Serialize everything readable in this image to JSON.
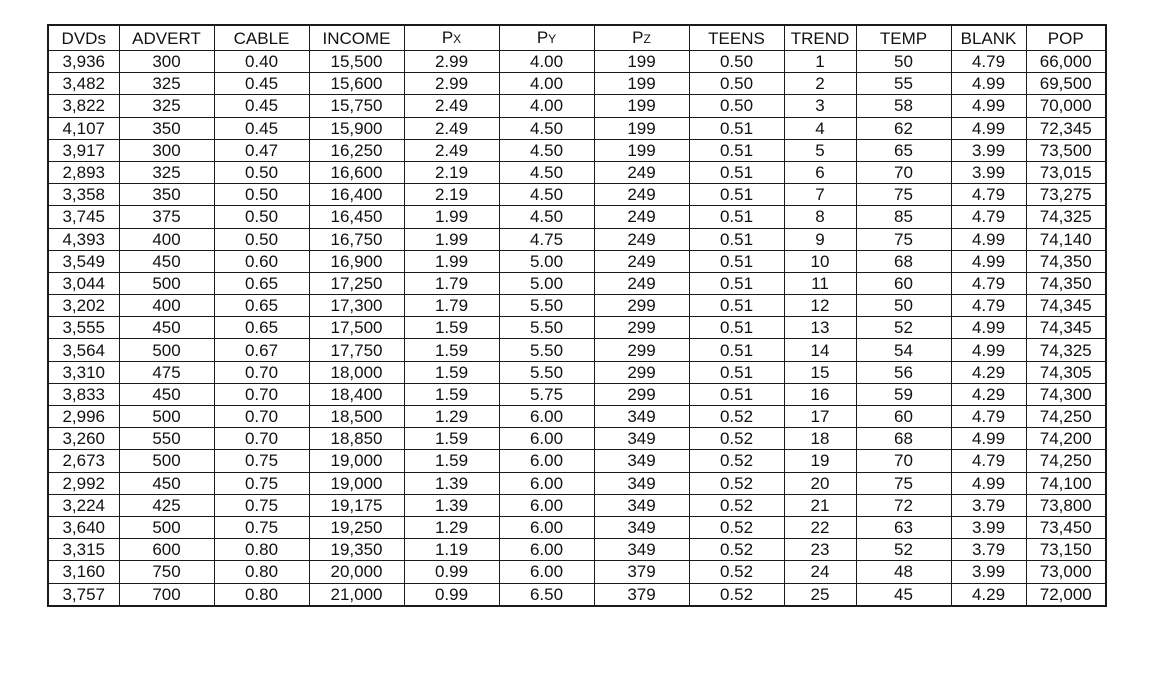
{
  "table": {
    "headers": [
      {
        "main": "DVDs",
        "sub": ""
      },
      {
        "main": "ADVERT",
        "sub": ""
      },
      {
        "main": "CABLE",
        "sub": ""
      },
      {
        "main": "INCOME",
        "sub": ""
      },
      {
        "main": "P",
        "sub": "X"
      },
      {
        "main": "P",
        "sub": "Y"
      },
      {
        "main": "P",
        "sub": "Z"
      },
      {
        "main": "TEENS",
        "sub": ""
      },
      {
        "main": "TREND",
        "sub": ""
      },
      {
        "main": "TEMP",
        "sub": ""
      },
      {
        "main": "BLANK",
        "sub": ""
      },
      {
        "main": "POP",
        "sub": ""
      }
    ],
    "rows": [
      [
        "3,936",
        "300",
        "0.40",
        "15,500",
        "2.99",
        "4.00",
        "199",
        "0.50",
        "1",
        "50",
        "4.79",
        "66,000"
      ],
      [
        "3,482",
        "325",
        "0.45",
        "15,600",
        "2.99",
        "4.00",
        "199",
        "0.50",
        "2",
        "55",
        "4.99",
        "69,500"
      ],
      [
        "3,822",
        "325",
        "0.45",
        "15,750",
        "2.49",
        "4.00",
        "199",
        "0.50",
        "3",
        "58",
        "4.99",
        "70,000"
      ],
      [
        "4,107",
        "350",
        "0.45",
        "15,900",
        "2.49",
        "4.50",
        "199",
        "0.51",
        "4",
        "62",
        "4.99",
        "72,345"
      ],
      [
        "3,917",
        "300",
        "0.47",
        "16,250",
        "2.49",
        "4.50",
        "199",
        "0.51",
        "5",
        "65",
        "3.99",
        "73,500"
      ],
      [
        "2,893",
        "325",
        "0.50",
        "16,600",
        "2.19",
        "4.50",
        "249",
        "0.51",
        "6",
        "70",
        "3.99",
        "73,015"
      ],
      [
        "3,358",
        "350",
        "0.50",
        "16,400",
        "2.19",
        "4.50",
        "249",
        "0.51",
        "7",
        "75",
        "4.79",
        "73,275"
      ],
      [
        "3,745",
        "375",
        "0.50",
        "16,450",
        "1.99",
        "4.50",
        "249",
        "0.51",
        "8",
        "85",
        "4.79",
        "74,325"
      ],
      [
        "4,393",
        "400",
        "0.50",
        "16,750",
        "1.99",
        "4.75",
        "249",
        "0.51",
        "9",
        "75",
        "4.99",
        "74,140"
      ],
      [
        "3,549",
        "450",
        "0.60",
        "16,900",
        "1.99",
        "5.00",
        "249",
        "0.51",
        "10",
        "68",
        "4.99",
        "74,350"
      ],
      [
        "3,044",
        "500",
        "0.65",
        "17,250",
        "1.79",
        "5.00",
        "249",
        "0.51",
        "11",
        "60",
        "4.79",
        "74,350"
      ],
      [
        "3,202",
        "400",
        "0.65",
        "17,300",
        "1.79",
        "5.50",
        "299",
        "0.51",
        "12",
        "50",
        "4.79",
        "74,345"
      ],
      [
        "3,555",
        "450",
        "0.65",
        "17,500",
        "1.59",
        "5.50",
        "299",
        "0.51",
        "13",
        "52",
        "4.99",
        "74,345"
      ],
      [
        "3,564",
        "500",
        "0.67",
        "17,750",
        "1.59",
        "5.50",
        "299",
        "0.51",
        "14",
        "54",
        "4.99",
        "74,325"
      ],
      [
        "3,310",
        "475",
        "0.70",
        "18,000",
        "1.59",
        "5.50",
        "299",
        "0.51",
        "15",
        "56",
        "4.29",
        "74,305"
      ],
      [
        "3,833",
        "450",
        "0.70",
        "18,400",
        "1.59",
        "5.75",
        "299",
        "0.51",
        "16",
        "59",
        "4.29",
        "74,300"
      ],
      [
        "2,996",
        "500",
        "0.70",
        "18,500",
        "1.29",
        "6.00",
        "349",
        "0.52",
        "17",
        "60",
        "4.79",
        "74,250"
      ],
      [
        "3,260",
        "550",
        "0.70",
        "18,850",
        "1.59",
        "6.00",
        "349",
        "0.52",
        "18",
        "68",
        "4.99",
        "74,200"
      ],
      [
        "2,673",
        "500",
        "0.75",
        "19,000",
        "1.59",
        "6.00",
        "349",
        "0.52",
        "19",
        "70",
        "4.79",
        "74,250"
      ],
      [
        "2,992",
        "450",
        "0.75",
        "19,000",
        "1.39",
        "6.00",
        "349",
        "0.52",
        "20",
        "75",
        "4.99",
        "74,100"
      ],
      [
        "3,224",
        "425",
        "0.75",
        "19,175",
        "1.39",
        "6.00",
        "349",
        "0.52",
        "21",
        "72",
        "3.79",
        "73,800"
      ],
      [
        "3,640",
        "500",
        "0.75",
        "19,250",
        "1.29",
        "6.00",
        "349",
        "0.52",
        "22",
        "63",
        "3.99",
        "73,450"
      ],
      [
        "3,315",
        "600",
        "0.80",
        "19,350",
        "1.19",
        "6.00",
        "349",
        "0.52",
        "23",
        "52",
        "3.79",
        "73,150"
      ],
      [
        "3,160",
        "750",
        "0.80",
        "20,000",
        "0.99",
        "6.00",
        "379",
        "0.52",
        "24",
        "48",
        "3.99",
        "73,000"
      ],
      [
        "3,757",
        "700",
        "0.80",
        "21,000",
        "0.99",
        "6.50",
        "379",
        "0.52",
        "25",
        "45",
        "4.29",
        "72,000"
      ]
    ]
  }
}
